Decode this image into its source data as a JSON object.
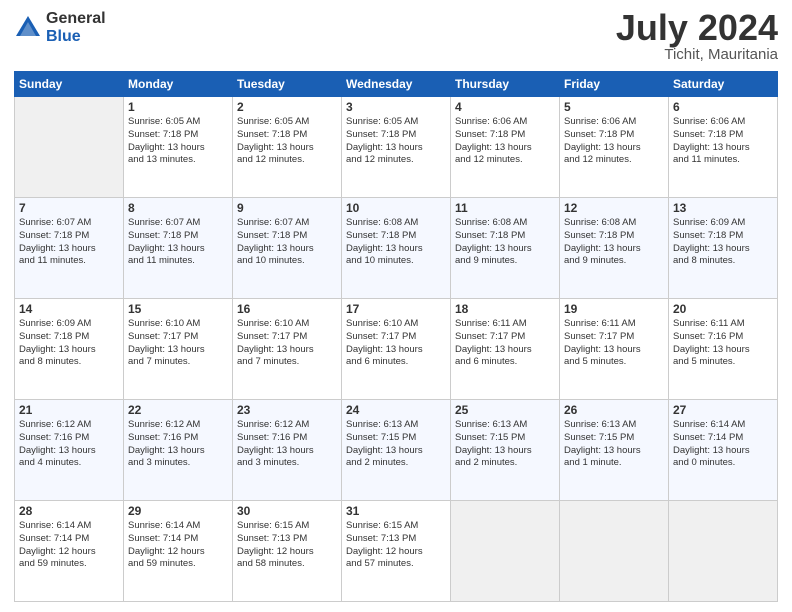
{
  "logo": {
    "general": "General",
    "blue": "Blue"
  },
  "title": {
    "month_year": "July 2024",
    "location": "Tichit, Mauritania"
  },
  "calendar": {
    "days_of_week": [
      "Sunday",
      "Monday",
      "Tuesday",
      "Wednesday",
      "Thursday",
      "Friday",
      "Saturday"
    ],
    "weeks": [
      [
        {
          "day": null,
          "info": null
        },
        {
          "day": "1",
          "info": "Sunrise: 6:05 AM\nSunset: 7:18 PM\nDaylight: 13 hours\nand 13 minutes."
        },
        {
          "day": "2",
          "info": "Sunrise: 6:05 AM\nSunset: 7:18 PM\nDaylight: 13 hours\nand 12 minutes."
        },
        {
          "day": "3",
          "info": "Sunrise: 6:05 AM\nSunset: 7:18 PM\nDaylight: 13 hours\nand 12 minutes."
        },
        {
          "day": "4",
          "info": "Sunrise: 6:06 AM\nSunset: 7:18 PM\nDaylight: 13 hours\nand 12 minutes."
        },
        {
          "day": "5",
          "info": "Sunrise: 6:06 AM\nSunset: 7:18 PM\nDaylight: 13 hours\nand 12 minutes."
        },
        {
          "day": "6",
          "info": "Sunrise: 6:06 AM\nSunset: 7:18 PM\nDaylight: 13 hours\nand 11 minutes."
        }
      ],
      [
        {
          "day": "7",
          "info": "Sunrise: 6:07 AM\nSunset: 7:18 PM\nDaylight: 13 hours\nand 11 minutes."
        },
        {
          "day": "8",
          "info": "Sunrise: 6:07 AM\nSunset: 7:18 PM\nDaylight: 13 hours\nand 11 minutes."
        },
        {
          "day": "9",
          "info": "Sunrise: 6:07 AM\nSunset: 7:18 PM\nDaylight: 13 hours\nand 10 minutes."
        },
        {
          "day": "10",
          "info": "Sunrise: 6:08 AM\nSunset: 7:18 PM\nDaylight: 13 hours\nand 10 minutes."
        },
        {
          "day": "11",
          "info": "Sunrise: 6:08 AM\nSunset: 7:18 PM\nDaylight: 13 hours\nand 9 minutes."
        },
        {
          "day": "12",
          "info": "Sunrise: 6:08 AM\nSunset: 7:18 PM\nDaylight: 13 hours\nand 9 minutes."
        },
        {
          "day": "13",
          "info": "Sunrise: 6:09 AM\nSunset: 7:18 PM\nDaylight: 13 hours\nand 8 minutes."
        }
      ],
      [
        {
          "day": "14",
          "info": "Sunrise: 6:09 AM\nSunset: 7:18 PM\nDaylight: 13 hours\nand 8 minutes."
        },
        {
          "day": "15",
          "info": "Sunrise: 6:10 AM\nSunset: 7:17 PM\nDaylight: 13 hours\nand 7 minutes."
        },
        {
          "day": "16",
          "info": "Sunrise: 6:10 AM\nSunset: 7:17 PM\nDaylight: 13 hours\nand 7 minutes."
        },
        {
          "day": "17",
          "info": "Sunrise: 6:10 AM\nSunset: 7:17 PM\nDaylight: 13 hours\nand 6 minutes."
        },
        {
          "day": "18",
          "info": "Sunrise: 6:11 AM\nSunset: 7:17 PM\nDaylight: 13 hours\nand 6 minutes."
        },
        {
          "day": "19",
          "info": "Sunrise: 6:11 AM\nSunset: 7:17 PM\nDaylight: 13 hours\nand 5 minutes."
        },
        {
          "day": "20",
          "info": "Sunrise: 6:11 AM\nSunset: 7:16 PM\nDaylight: 13 hours\nand 5 minutes."
        }
      ],
      [
        {
          "day": "21",
          "info": "Sunrise: 6:12 AM\nSunset: 7:16 PM\nDaylight: 13 hours\nand 4 minutes."
        },
        {
          "day": "22",
          "info": "Sunrise: 6:12 AM\nSunset: 7:16 PM\nDaylight: 13 hours\nand 3 minutes."
        },
        {
          "day": "23",
          "info": "Sunrise: 6:12 AM\nSunset: 7:16 PM\nDaylight: 13 hours\nand 3 minutes."
        },
        {
          "day": "24",
          "info": "Sunrise: 6:13 AM\nSunset: 7:15 PM\nDaylight: 13 hours\nand 2 minutes."
        },
        {
          "day": "25",
          "info": "Sunrise: 6:13 AM\nSunset: 7:15 PM\nDaylight: 13 hours\nand 2 minutes."
        },
        {
          "day": "26",
          "info": "Sunrise: 6:13 AM\nSunset: 7:15 PM\nDaylight: 13 hours\nand 1 minute."
        },
        {
          "day": "27",
          "info": "Sunrise: 6:14 AM\nSunset: 7:14 PM\nDaylight: 13 hours\nand 0 minutes."
        }
      ],
      [
        {
          "day": "28",
          "info": "Sunrise: 6:14 AM\nSunset: 7:14 PM\nDaylight: 12 hours\nand 59 minutes."
        },
        {
          "day": "29",
          "info": "Sunrise: 6:14 AM\nSunset: 7:14 PM\nDaylight: 12 hours\nand 59 minutes."
        },
        {
          "day": "30",
          "info": "Sunrise: 6:15 AM\nSunset: 7:13 PM\nDaylight: 12 hours\nand 58 minutes."
        },
        {
          "day": "31",
          "info": "Sunrise: 6:15 AM\nSunset: 7:13 PM\nDaylight: 12 hours\nand 57 minutes."
        },
        {
          "day": null,
          "info": null
        },
        {
          "day": null,
          "info": null
        },
        {
          "day": null,
          "info": null
        }
      ]
    ]
  }
}
